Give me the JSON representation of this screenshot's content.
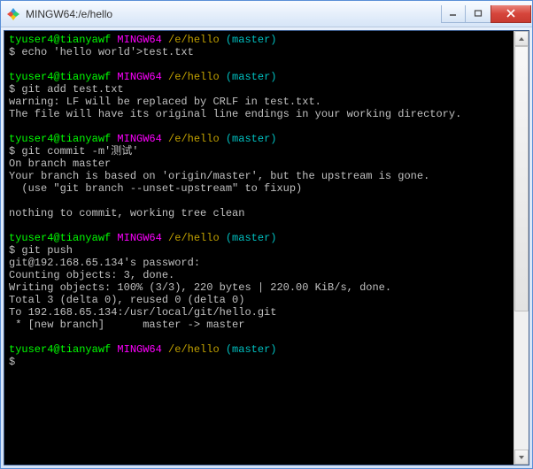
{
  "titlebar": {
    "title": "MINGW64:/e/hello"
  },
  "prompt_parts": {
    "user": "tyuser4@tianyawf",
    "host": "MINGW64",
    "path": "/e/hello",
    "branch": "(master)"
  },
  "block1": {
    "cmd": "$ echo 'hello world'>test.txt"
  },
  "block2": {
    "cmd": "$ git add test.txt",
    "out1": "warning: LF will be replaced by CRLF in test.txt.",
    "out2": "The file will have its original line endings in your working directory."
  },
  "block3": {
    "cmd": "$ git commit -m'测试'",
    "out1": "On branch master",
    "out2": "Your branch is based on 'origin/master', but the upstream is gone.",
    "out3": "  (use \"git branch --unset-upstream\" to fixup)",
    "out4": "nothing to commit, working tree clean"
  },
  "block4": {
    "cmd": "$ git push",
    "out1": "git@192.168.65.134's password:",
    "out2": "Counting objects: 3, done.",
    "out3": "Writing objects: 100% (3/3), 220 bytes | 220.00 KiB/s, done.",
    "out4": "Total 3 (delta 0), reused 0 (delta 0)",
    "out5": "To 192.168.65.134:/usr/local/git/hello.git",
    "out6": " * [new branch]      master -> master"
  },
  "block5": {
    "cmd": "$"
  }
}
